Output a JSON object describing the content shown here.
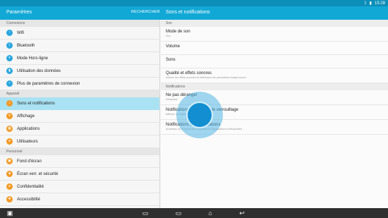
{
  "status_bar": {
    "time": "15:28",
    "icons": [
      "bluetooth-icon",
      "battery-icon"
    ]
  },
  "app_bar": {
    "title": "Paramètres",
    "search_label": "RECHERCHER",
    "right_title": "Sons et notifications"
  },
  "left": {
    "sections": [
      {
        "title": "Connexions",
        "items": [
          {
            "label": "Wifi",
            "icon": "wifi-icon",
            "color": "#2aa6df"
          },
          {
            "label": "Bluetooth",
            "icon": "bluetooth-icon",
            "color": "#2aa6df"
          },
          {
            "label": "Mode Hors-ligne",
            "icon": "airplane-icon",
            "color": "#2aa6df"
          },
          {
            "label": "Utilisation des données",
            "icon": "data-usage-icon",
            "color": "#2aa6df"
          },
          {
            "label": "Plus de paramètres de connexion",
            "icon": "more-connections-icon",
            "color": "#2aa6df"
          }
        ]
      },
      {
        "title": "Appareil",
        "items": [
          {
            "label": "Sons et notifications",
            "icon": "sound-icon",
            "color": "#f39a25",
            "active": true
          },
          {
            "label": "Affichage",
            "icon": "display-icon",
            "color": "#f39a25"
          },
          {
            "label": "Applications",
            "icon": "apps-icon",
            "color": "#f39a25"
          },
          {
            "label": "Utilisateurs",
            "icon": "users-icon",
            "color": "#f39a25"
          }
        ]
      },
      {
        "title": "Personnel",
        "items": [
          {
            "label": "Fond d'écran",
            "icon": "wallpaper-icon",
            "color": "#f39a25"
          },
          {
            "label": "Écran verr. et sécurité",
            "icon": "lock-icon",
            "color": "#f39a25"
          },
          {
            "label": "Confidentialité",
            "icon": "privacy-icon",
            "color": "#f39a25"
          },
          {
            "label": "Accessibilité",
            "icon": "accessibility-icon",
            "color": "#f39a25"
          }
        ]
      }
    ]
  },
  "right": {
    "sections": [
      {
        "title": "Son",
        "items": [
          {
            "title": "Mode de son",
            "subtitle": "Son"
          },
          {
            "title": "Volume"
          },
          {
            "title": "Sons"
          },
          {
            "title": "Qualité et effets sonores",
            "subtitle": "Activez les effets sonores et définissez les paramètres Adapt sound."
          }
        ]
      },
      {
        "title": "Notifications",
        "items": [
          {
            "title": "Ne pas déranger",
            "subtitle": "Désactivé"
          },
          {
            "title": "Notifications sur l'écran de verrouillage",
            "subtitle": "Afficher le contenu"
          },
          {
            "title": "Notifications des applications",
            "subtitle": "Autorisez ou bloquez les notifications d'applications individuelles."
          }
        ]
      }
    ]
  },
  "nav_bar": {
    "icons": [
      "gallery-icon",
      "recent-apps-icon",
      "screenshot-icon",
      "home-icon",
      "back-icon"
    ]
  }
}
